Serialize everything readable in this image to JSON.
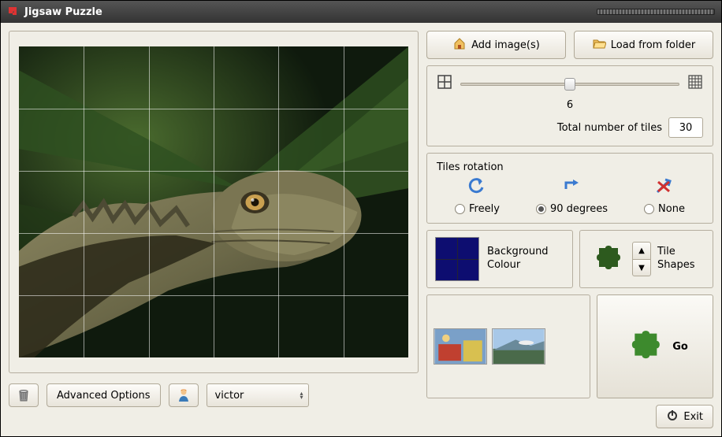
{
  "window": {
    "title": "Jigsaw Puzzle"
  },
  "toolbar": {
    "add_image": "Add image(s)",
    "load_folder": "Load from folder"
  },
  "slider": {
    "value": "6",
    "position_pct": 50,
    "total_label": "Total number of tiles",
    "total_value": "30"
  },
  "rotation": {
    "title": "Tiles rotation",
    "options": {
      "freely": "Freely",
      "ninety": "90 degrees",
      "none": "None"
    },
    "selected": "ninety"
  },
  "bgcolor": {
    "label": "Background Colour"
  },
  "shapes": {
    "label": "Tile Shapes"
  },
  "go": {
    "label": "Go"
  },
  "bottom": {
    "advanced": "Advanced Options",
    "user": "victor",
    "exit": "Exit"
  },
  "grid": {
    "cols": 6,
    "rows": 5
  }
}
